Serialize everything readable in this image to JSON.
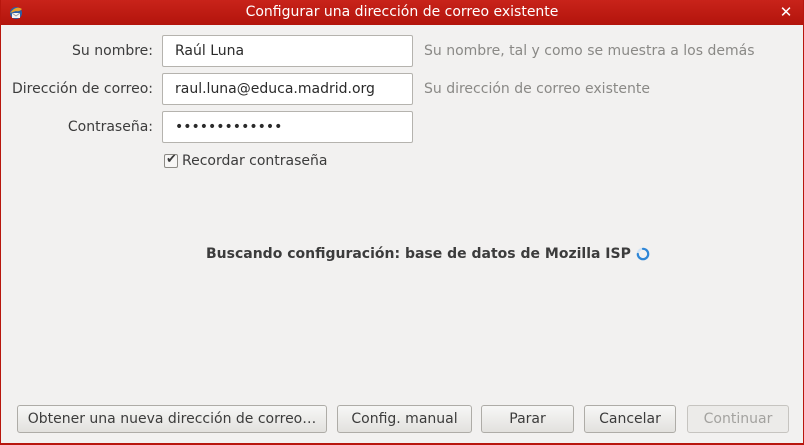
{
  "window": {
    "title": "Configurar una dirección de correo existente",
    "close_symbol": "✕"
  },
  "form": {
    "name": {
      "label": "Su nombre:",
      "value": "Raúl Luna",
      "hint": "Su nombre, tal y como se muestra a los demás"
    },
    "email": {
      "label": "Dirección de correo:",
      "value": "raul.luna@educa.madrid.org",
      "hint": "Su dirección de correo existente"
    },
    "password": {
      "label": "Contraseña:",
      "value": "•••••••••••••"
    },
    "remember": {
      "label": "Recordar contraseña",
      "checked": true,
      "check_symbol": "✔"
    }
  },
  "status": {
    "text": "Buscando configuración: base de datos de Mozilla ISP"
  },
  "buttons": {
    "new_address": "Obtener una nueva dirección de correo…",
    "manual_config": "Config. manual",
    "stop": "Parar",
    "cancel": "Cancelar",
    "continue": "Continuar"
  },
  "icons": {
    "app": "thunderbird-icon",
    "close": "close-icon",
    "checkbox": "checkbox-icon",
    "spinner": "spinner-icon"
  },
  "colors": {
    "titlebar": "#b3140c",
    "background": "#f2f1f0",
    "spinner": "#2f86d6"
  }
}
